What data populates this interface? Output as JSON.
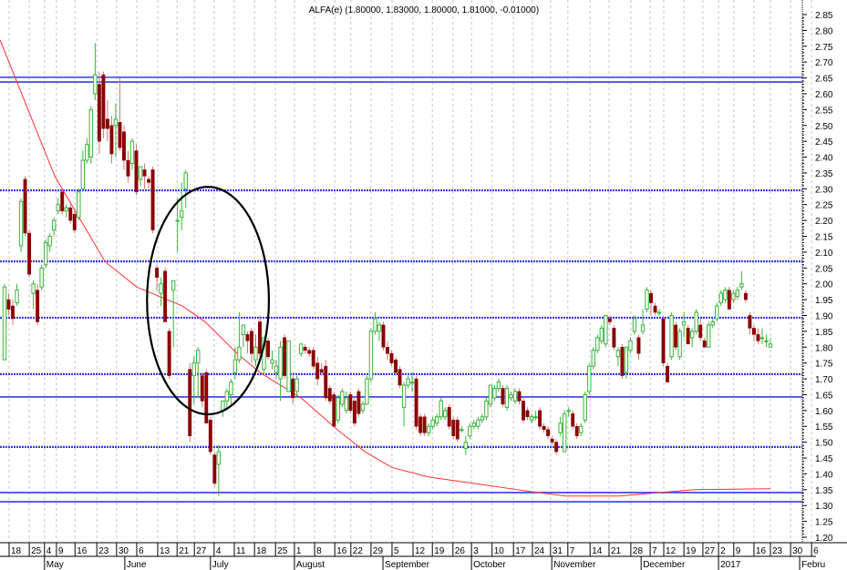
{
  "chart_data": {
    "type": "candlestick",
    "title": "ALFA(e) (1.80000, 1.83000, 1.80000, 1.81000, -0.01000)",
    "ylim": [
      1.2,
      2.85
    ],
    "ytick_step": 0.05,
    "grid": "vertical-dotted",
    "candles_ohlc": [
      [
        1.76,
        2.0,
        1.76,
        1.99
      ],
      [
        1.95,
        1.97,
        1.9,
        1.92
      ],
      [
        1.93,
        1.95,
        1.87,
        1.89
      ],
      [
        1.94,
        2.0,
        1.93,
        1.98
      ],
      [
        2.12,
        2.27,
        2.1,
        2.26
      ],
      [
        2.33,
        2.34,
        2.15,
        2.16
      ],
      [
        2.16,
        2.17,
        2.02,
        2.03
      ],
      [
        1.97,
        2.01,
        1.92,
        2.0
      ],
      [
        1.98,
        2.0,
        1.87,
        1.88
      ],
      [
        1.99,
        2.06,
        1.98,
        2.05
      ],
      [
        2.06,
        2.14,
        2.05,
        2.13
      ],
      [
        2.12,
        2.16,
        2.1,
        2.15
      ],
      [
        2.17,
        2.21,
        2.15,
        2.2
      ],
      [
        2.23,
        2.27,
        2.22,
        2.25
      ],
      [
        2.29,
        2.3,
        2.22,
        2.23
      ],
      [
        2.23,
        2.25,
        2.21,
        2.24
      ],
      [
        2.24,
        2.26,
        2.19,
        2.2
      ],
      [
        2.22,
        2.23,
        2.16,
        2.17
      ],
      [
        2.21,
        2.3,
        2.2,
        2.29
      ],
      [
        2.3,
        2.42,
        2.29,
        2.39
      ],
      [
        2.39,
        2.46,
        2.38,
        2.44
      ],
      [
        2.4,
        2.56,
        2.38,
        2.55
      ],
      [
        2.6,
        2.76,
        2.58,
        2.66
      ],
      [
        2.63,
        2.67,
        2.41,
        2.45
      ],
      [
        2.66,
        2.67,
        2.46,
        2.49
      ],
      [
        2.52,
        2.58,
        2.45,
        2.49
      ],
      [
        2.5,
        2.53,
        2.38,
        2.41
      ],
      [
        2.5,
        2.57,
        2.4,
        2.52
      ],
      [
        2.51,
        2.65,
        2.42,
        2.43
      ],
      [
        2.48,
        2.5,
        2.36,
        2.39
      ],
      [
        2.39,
        2.42,
        2.32,
        2.34
      ],
      [
        2.38,
        2.46,
        2.36,
        2.45
      ],
      [
        2.42,
        2.44,
        2.28,
        2.29
      ],
      [
        2.33,
        2.37,
        2.31,
        2.37
      ],
      [
        2.36,
        2.38,
        2.3,
        2.34
      ],
      [
        2.33,
        2.34,
        2.3,
        2.32
      ],
      [
        2.36,
        2.37,
        2.16,
        2.17
      ],
      [
        2.05,
        2.06,
        1.98,
        2.02
      ],
      [
        1.97,
        2.02,
        1.93,
        2.0
      ],
      [
        2.04,
        2.05,
        1.88,
        1.88
      ],
      [
        1.85,
        1.86,
        1.7,
        1.71
      ],
      [
        1.98,
        2.01,
        1.8,
        2.01
      ],
      [
        2.2,
        2.27,
        2.1,
        2.2
      ],
      [
        2.21,
        2.32,
        2.17,
        2.23
      ],
      [
        2.3,
        2.36,
        2.24,
        2.35
      ],
      [
        1.73,
        1.75,
        1.5,
        1.52
      ],
      [
        1.71,
        1.77,
        1.62,
        1.75
      ],
      [
        1.75,
        1.8,
        1.64,
        1.79
      ],
      [
        1.71,
        1.72,
        1.61,
        1.63
      ],
      [
        1.72,
        1.73,
        1.56,
        1.56
      ],
      [
        1.57,
        1.58,
        1.46,
        1.47
      ],
      [
        1.46,
        1.47,
        1.36,
        1.37
      ],
      [
        1.43,
        1.49,
        1.33,
        1.47
      ],
      [
        1.6,
        1.63,
        1.58,
        1.63
      ],
      [
        1.63,
        1.67,
        1.6,
        1.66
      ],
      [
        1.65,
        1.7,
        1.62,
        1.69
      ],
      [
        1.72,
        1.8,
        1.7,
        1.76
      ],
      [
        1.76,
        1.91,
        1.75,
        1.8
      ],
      [
        1.84,
        1.87,
        1.8,
        1.87
      ],
      [
        1.84,
        1.85,
        1.78,
        1.82
      ],
      [
        1.85,
        1.86,
        1.75,
        1.78
      ],
      [
        1.76,
        1.84,
        1.74,
        1.8
      ],
      [
        1.88,
        1.9,
        1.77,
        1.78
      ],
      [
        1.73,
        1.83,
        1.72,
        1.83
      ],
      [
        1.82,
        1.83,
        1.76,
        1.77
      ],
      [
        1.75,
        1.79,
        1.73,
        1.76
      ],
      [
        1.72,
        1.76,
        1.7,
        1.74
      ],
      [
        1.7,
        1.82,
        1.63,
        1.8
      ],
      [
        1.83,
        1.84,
        1.7,
        1.71
      ],
      [
        1.66,
        1.82,
        1.66,
        1.82
      ],
      [
        1.7,
        1.72,
        1.62,
        1.64
      ],
      [
        1.66,
        1.71,
        1.64,
        1.7
      ],
      [
        1.78,
        1.81,
        1.77,
        1.81
      ],
      [
        1.8,
        1.81,
        1.78,
        1.79
      ],
      [
        1.79,
        1.8,
        1.77,
        1.78
      ],
      [
        1.79,
        1.8,
        1.73,
        1.74
      ],
      [
        1.75,
        1.77,
        1.68,
        1.7
      ],
      [
        1.73,
        1.75,
        1.71,
        1.72
      ],
      [
        1.74,
        1.76,
        1.63,
        1.64
      ],
      [
        1.67,
        1.68,
        1.62,
        1.63
      ],
      [
        1.65,
        1.66,
        1.55,
        1.55
      ],
      [
        1.57,
        1.65,
        1.56,
        1.64
      ],
      [
        1.62,
        1.67,
        1.61,
        1.66
      ],
      [
        1.6,
        1.66,
        1.59,
        1.64
      ],
      [
        1.65,
        1.66,
        1.59,
        1.6
      ],
      [
        1.63,
        1.64,
        1.55,
        1.56
      ],
      [
        1.66,
        1.67,
        1.58,
        1.59
      ],
      [
        1.6,
        1.63,
        1.59,
        1.62
      ],
      [
        1.62,
        1.71,
        1.62,
        1.7
      ],
      [
        1.7,
        1.86,
        1.69,
        1.85
      ],
      [
        1.85,
        1.91,
        1.84,
        1.89
      ],
      [
        1.85,
        1.88,
        1.82,
        1.87
      ],
      [
        1.87,
        1.88,
        1.79,
        1.8
      ],
      [
        1.8,
        1.82,
        1.76,
        1.78
      ],
      [
        1.78,
        1.79,
        1.74,
        1.75
      ],
      [
        1.76,
        1.77,
        1.71,
        1.72
      ],
      [
        1.73,
        1.74,
        1.67,
        1.68
      ],
      [
        1.61,
        1.69,
        1.55,
        1.68
      ],
      [
        1.68,
        1.71,
        1.67,
        1.7
      ],
      [
        1.69,
        1.72,
        1.66,
        1.69
      ],
      [
        1.7,
        1.71,
        1.54,
        1.55
      ],
      [
        1.58,
        1.59,
        1.52,
        1.53
      ],
      [
        1.58,
        1.59,
        1.52,
        1.53
      ],
      [
        1.53,
        1.56,
        1.52,
        1.55
      ],
      [
        1.55,
        1.58,
        1.54,
        1.57
      ],
      [
        1.56,
        1.59,
        1.55,
        1.58
      ],
      [
        1.58,
        1.64,
        1.57,
        1.63
      ],
      [
        1.58,
        1.61,
        1.57,
        1.6
      ],
      [
        1.61,
        1.62,
        1.54,
        1.55
      ],
      [
        1.57,
        1.58,
        1.51,
        1.52
      ],
      [
        1.57,
        1.58,
        1.5,
        1.51
      ],
      [
        1.54,
        1.55,
        1.53,
        1.54
      ],
      [
        1.48,
        1.52,
        1.46,
        1.5
      ],
      [
        1.52,
        1.56,
        1.51,
        1.55
      ],
      [
        1.55,
        1.57,
        1.54,
        1.56
      ],
      [
        1.55,
        1.58,
        1.54,
        1.57
      ],
      [
        1.57,
        1.59,
        1.56,
        1.58
      ],
      [
        1.58,
        1.64,
        1.57,
        1.63
      ],
      [
        1.62,
        1.68,
        1.61,
        1.68
      ],
      [
        1.64,
        1.68,
        1.63,
        1.67
      ],
      [
        1.67,
        1.7,
        1.66,
        1.69
      ],
      [
        1.67,
        1.68,
        1.61,
        1.62
      ],
      [
        1.61,
        1.68,
        1.6,
        1.67
      ],
      [
        1.64,
        1.66,
        1.63,
        1.65
      ],
      [
        1.63,
        1.67,
        1.62,
        1.66
      ],
      [
        1.66,
        1.67,
        1.62,
        1.63
      ],
      [
        1.63,
        1.64,
        1.56,
        1.57
      ],
      [
        1.6,
        1.61,
        1.57,
        1.58
      ],
      [
        1.57,
        1.59,
        1.56,
        1.58
      ],
      [
        1.58,
        1.6,
        1.57,
        1.58
      ],
      [
        1.6,
        1.61,
        1.54,
        1.55
      ],
      [
        1.55,
        1.56,
        1.53,
        1.54
      ],
      [
        1.54,
        1.55,
        1.51,
        1.52
      ],
      [
        1.51,
        1.52,
        1.49,
        1.5
      ],
      [
        1.5,
        1.51,
        1.46,
        1.47
      ],
      [
        1.53,
        1.58,
        1.52,
        1.56
      ],
      [
        1.47,
        1.6,
        1.47,
        1.59
      ],
      [
        1.6,
        1.61,
        1.58,
        1.6
      ],
      [
        1.59,
        1.6,
        1.54,
        1.55
      ],
      [
        1.55,
        1.56,
        1.51,
        1.52
      ],
      [
        1.53,
        1.56,
        1.52,
        1.55
      ],
      [
        1.57,
        1.66,
        1.56,
        1.65
      ],
      [
        1.66,
        1.75,
        1.65,
        1.74
      ],
      [
        1.74,
        1.8,
        1.73,
        1.79
      ],
      [
        1.79,
        1.84,
        1.78,
        1.83
      ],
      [
        1.82,
        1.87,
        1.81,
        1.86
      ],
      [
        1.81,
        1.9,
        1.8,
        1.9
      ],
      [
        1.89,
        1.9,
        1.87,
        1.88
      ],
      [
        1.86,
        1.87,
        1.79,
        1.8
      ],
      [
        1.77,
        1.8,
        1.74,
        1.79
      ],
      [
        1.8,
        1.81,
        1.7,
        1.71
      ],
      [
        1.72,
        1.8,
        1.7,
        1.8
      ],
      [
        1.79,
        1.83,
        1.78,
        1.82
      ],
      [
        1.85,
        1.9,
        1.84,
        1.89
      ],
      [
        1.83,
        1.84,
        1.76,
        1.78
      ],
      [
        1.85,
        1.92,
        1.84,
        1.87
      ],
      [
        1.92,
        1.99,
        1.91,
        1.98
      ],
      [
        1.97,
        1.98,
        1.9,
        1.94
      ],
      [
        1.93,
        1.94,
        1.9,
        1.91
      ],
      [
        1.91,
        1.92,
        1.9,
        1.91
      ],
      [
        1.89,
        1.9,
        1.74,
        1.75
      ],
      [
        1.74,
        1.75,
        1.69,
        1.69
      ],
      [
        1.77,
        1.91,
        1.76,
        1.9
      ],
      [
        1.87,
        1.88,
        1.79,
        1.8
      ],
      [
        1.77,
        1.86,
        1.76,
        1.85
      ],
      [
        1.87,
        1.91,
        1.83,
        1.88
      ],
      [
        1.86,
        1.87,
        1.81,
        1.81
      ],
      [
        1.83,
        1.86,
        1.8,
        1.85
      ],
      [
        1.85,
        1.92,
        1.84,
        1.91
      ],
      [
        1.87,
        1.89,
        1.82,
        1.83
      ],
      [
        1.82,
        1.83,
        1.8,
        1.8
      ],
      [
        1.8,
        1.88,
        1.8,
        1.87
      ],
      [
        1.87,
        1.89,
        1.86,
        1.88
      ],
      [
        1.89,
        1.94,
        1.88,
        1.93
      ],
      [
        1.94,
        1.98,
        1.93,
        1.97
      ],
      [
        1.95,
        1.99,
        1.94,
        1.98
      ],
      [
        1.98,
        1.99,
        1.92,
        1.92
      ],
      [
        1.95,
        1.98,
        1.94,
        1.97
      ],
      [
        1.96,
        1.99,
        1.95,
        1.98
      ],
      [
        1.99,
        2.04,
        1.98,
        2.0
      ],
      [
        1.97,
        1.98,
        1.94,
        1.95
      ],
      [
        1.9,
        1.91,
        1.84,
        1.86
      ],
      [
        1.86,
        1.87,
        1.82,
        1.84
      ],
      [
        1.84,
        1.86,
        1.81,
        1.82
      ],
      [
        1.83,
        1.86,
        1.81,
        1.83
      ],
      [
        1.82,
        1.84,
        1.8,
        1.82
      ],
      [
        1.8,
        1.83,
        1.8,
        1.81
      ]
    ],
    "moving_average": [
      [
        -1.1,
        2.77
      ],
      [
        12.2,
        2.34
      ],
      [
        24.4,
        2.07
      ],
      [
        32.1,
        1.99
      ],
      [
        43.2,
        1.93
      ],
      [
        48.7,
        1.88
      ],
      [
        56.5,
        1.78
      ],
      [
        62.0,
        1.72
      ],
      [
        72.0,
        1.64
      ],
      [
        80.8,
        1.54
      ],
      [
        87.5,
        1.47
      ],
      [
        94.1,
        1.42
      ],
      [
        103.0,
        1.39
      ],
      [
        114.0,
        1.37
      ],
      [
        127.3,
        1.345
      ],
      [
        136.2,
        1.33
      ],
      [
        149.5,
        1.33
      ],
      [
        158.3,
        1.34
      ],
      [
        167.2,
        1.35
      ],
      [
        186.0,
        1.353
      ]
    ],
    "horizontal_levels": [
      {
        "value": 2.652,
        "style": "solid"
      },
      {
        "value": 2.637,
        "style": "solid"
      },
      {
        "value": 2.295,
        "style": "dotted"
      },
      {
        "value": 2.071,
        "style": "dotted"
      },
      {
        "value": 1.893,
        "style": "dotted"
      },
      {
        "value": 1.715,
        "style": "dotted"
      },
      {
        "value": 1.643,
        "style": "solid"
      },
      {
        "value": 1.485,
        "style": "dotted"
      },
      {
        "value": 1.341,
        "style": "solid"
      },
      {
        "value": 1.312,
        "style": "solid"
      }
    ],
    "annotation_ellipse": {
      "center_index": 49.4,
      "center_price": 1.947,
      "radius_index": 14.8,
      "radius_price": 0.359
    },
    "x_ticks": [
      {
        "label": "18",
        "index": 1.1
      },
      {
        "label": "25",
        "index": 6.0
      },
      {
        "label": "4",
        "index": 9.7
      },
      {
        "label": "9",
        "index": 12.6
      },
      {
        "label": "16",
        "index": 17.1
      },
      {
        "label": "23",
        "index": 22.4
      },
      {
        "label": "30",
        "index": 27.2
      },
      {
        "label": "6",
        "index": 32.1
      },
      {
        "label": "13",
        "index": 37.2
      },
      {
        "label": "21",
        "index": 41.9
      },
      {
        "label": "27",
        "index": 46.1
      },
      {
        "label": "4",
        "index": 50.9
      },
      {
        "label": "11",
        "index": 55.8
      },
      {
        "label": "18",
        "index": 60.7
      },
      {
        "label": "25",
        "index": 65.8
      },
      {
        "label": "1",
        "index": 70.4
      },
      {
        "label": "8",
        "index": 75.3
      },
      {
        "label": "16",
        "index": 80.2
      },
      {
        "label": "22",
        "index": 84.1
      },
      {
        "label": "29",
        "index": 89.0
      },
      {
        "label": "5",
        "index": 94.1
      },
      {
        "label": "12",
        "index": 99.2
      },
      {
        "label": "19",
        "index": 103.9
      },
      {
        "label": "26",
        "index": 108.9
      },
      {
        "label": "3",
        "index": 113.4
      },
      {
        "label": "10",
        "index": 118.4
      },
      {
        "label": "17",
        "index": 123.6
      },
      {
        "label": "24",
        "index": 128.2
      },
      {
        "label": "31",
        "index": 132.6
      },
      {
        "label": "7",
        "index": 136.8
      },
      {
        "label": "14",
        "index": 142.2
      },
      {
        "label": "21",
        "index": 146.8
      },
      {
        "label": "28",
        "index": 152.1
      },
      {
        "label": "7",
        "index": 156.8
      },
      {
        "label": "12",
        "index": 160.1
      },
      {
        "label": "19",
        "index": 165.0
      },
      {
        "label": "27",
        "index": 169.6
      },
      {
        "label": "2",
        "index": 173.4
      },
      {
        "label": "9",
        "index": 177.1
      },
      {
        "label": "16",
        "index": 182.0
      },
      {
        "label": "23",
        "index": 186.0
      },
      {
        "label": "30",
        "index": 190.9
      },
      {
        "label": "6",
        "index": 196.0
      }
    ],
    "month_labels": [
      {
        "label": "May",
        "index": 9.7
      },
      {
        "label": "June",
        "index": 29.2
      },
      {
        "label": "July",
        "index": 50.0
      },
      {
        "label": "August",
        "index": 70.4
      },
      {
        "label": "September",
        "index": 91.9
      },
      {
        "label": "October",
        "index": 113.4
      },
      {
        "label": "November",
        "index": 132.9
      },
      {
        "label": "December",
        "index": 154.6
      },
      {
        "label": "2017",
        "index": 173.4
      },
      {
        "label": "Febru",
        "index": 193.1
      }
    ],
    "colors": {
      "up": "#3cb43c",
      "down": "#8b0000",
      "ma": "#ff3030",
      "levels": "#3838f0",
      "ellipse": "#000000",
      "grid": "#c8c8c8"
    }
  }
}
